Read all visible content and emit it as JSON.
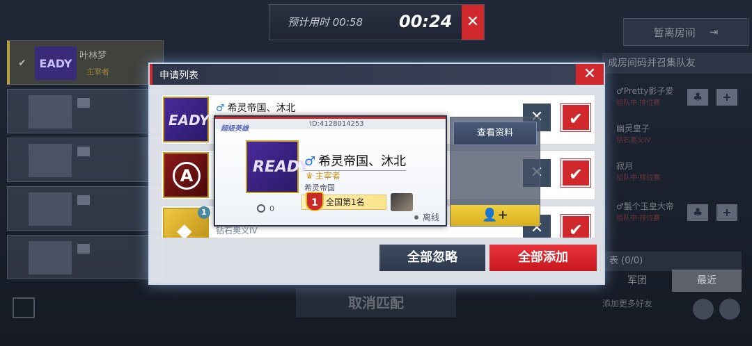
{
  "timer": {
    "estimate_label": "预计用时 00:58",
    "elapsed": "00:24",
    "close": "✕"
  },
  "background": {
    "player_name": "叶林梦",
    "player_title": "主宰者",
    "ready_text": "EADY",
    "dismiss_room": "暂离房间",
    "invite_text": "成房间码并召集队友",
    "friends": [
      {
        "name": "♂Pretty影子爱",
        "sub": "组队中·排位赛"
      },
      {
        "name": "幽灵皇子",
        "sub": "钻石奥义IV"
      },
      {
        "name": "寂月",
        "sub": "组队中·排位赛"
      },
      {
        "name": "♂鬣个玉皇大帝",
        "sub": "组队中·排位赛"
      }
    ],
    "list_count": "表 (0/0)",
    "tab_legion": "军团",
    "tab_recent": "最近",
    "more_friends": "添加更多好友",
    "cancel_match": "取消匹配"
  },
  "dialog": {
    "title": "申请列表",
    "close": "✕",
    "requests": [
      {
        "name": "希灵帝国、沐北",
        "male": "♂",
        "rank": "",
        "avatar": "ready",
        "avatar_text": "EADY"
      },
      {
        "name": "",
        "male": "",
        "rank": "",
        "avatar": "aveng",
        "avatar_text": "A"
      },
      {
        "name": "",
        "male": "",
        "rank": "钻石奥义IV",
        "avatar": "diamond",
        "avatar_text": "◆",
        "badge": "1"
      }
    ],
    "ignore_icon": "✕",
    "accept_icon": "✔",
    "ignore_all": "全部忽略",
    "add_all": "全部添加"
  },
  "popup": {
    "id": "ID:4128014253",
    "logo": "超级英雄",
    "avatar_text": "READY",
    "male": "♂",
    "name": "希灵帝国、沐北",
    "title": "主宰者",
    "guild": "希灵帝国",
    "rank_number": "1",
    "rank_text": "全国第1名",
    "stat_value": "0",
    "status": "离线",
    "view_profile": "查看资料",
    "add_friend_icon": "👤+"
  }
}
